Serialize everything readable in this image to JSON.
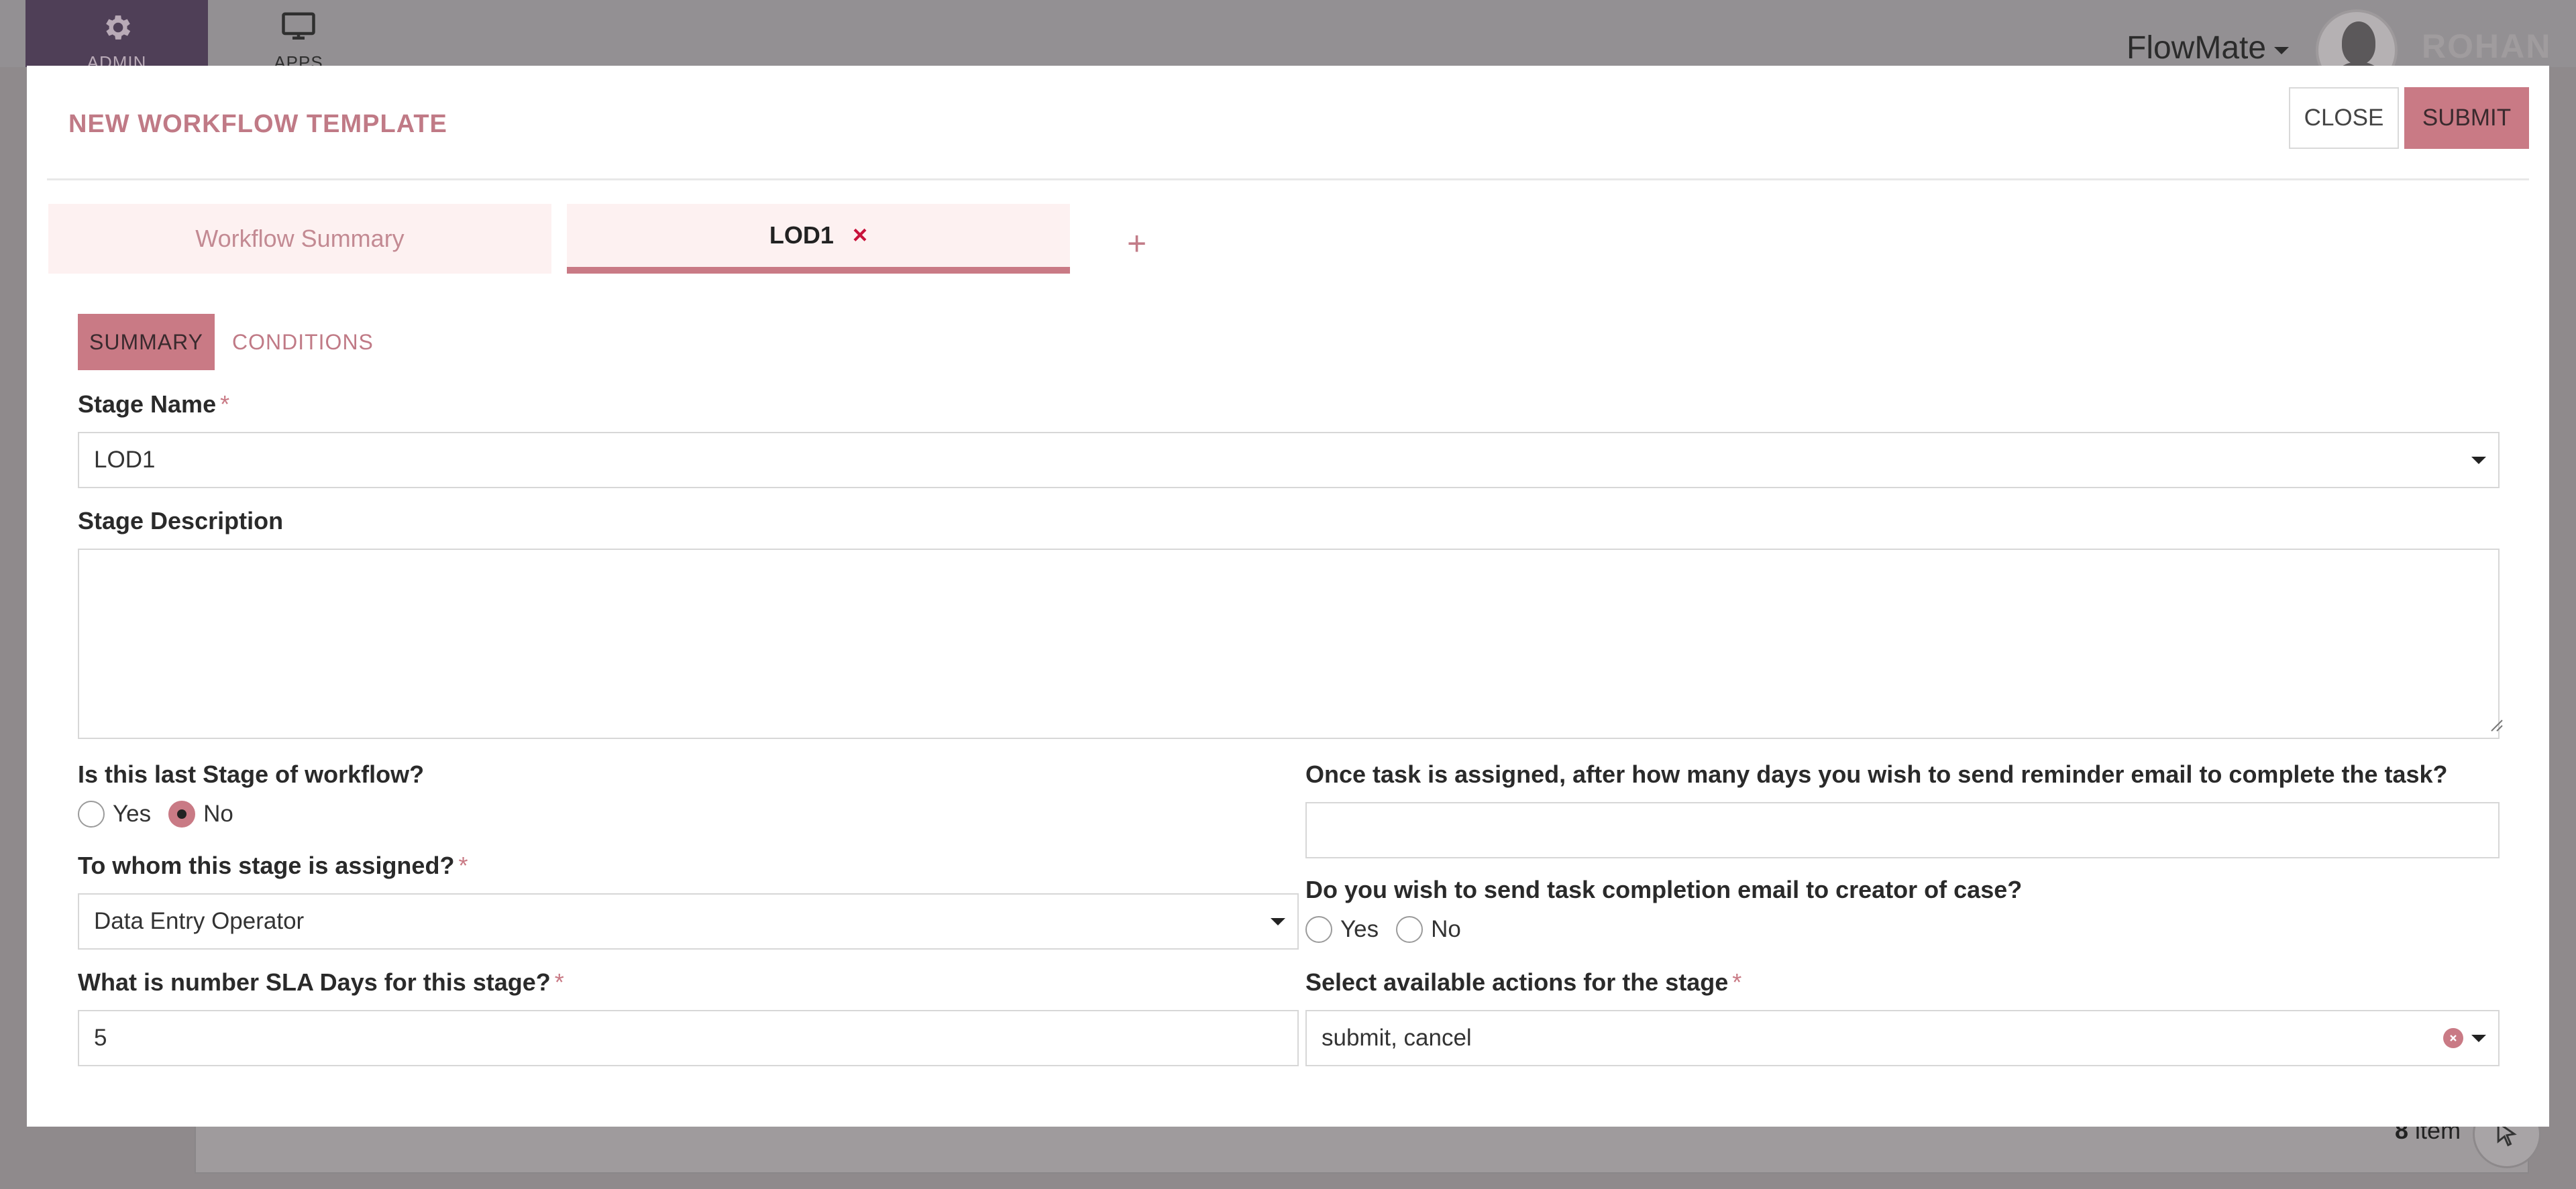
{
  "background": {
    "nav": {
      "admin_label": "ADMIN",
      "apps_label": "APPS"
    },
    "brand": "FlowMate",
    "user_name": "ROHAN",
    "items_count": "8",
    "items_label": "item"
  },
  "modal": {
    "title": "NEW WORKFLOW TEMPLATE",
    "close_label": "CLOSE",
    "submit_label": "SUBMIT",
    "stage_tabs": [
      {
        "label": "Workflow Summary",
        "active": false
      },
      {
        "label": "LOD1",
        "active": true,
        "remove_icon": "×"
      }
    ],
    "add_stage_icon": "+",
    "sub_tabs": [
      {
        "label": "SUMMARY",
        "active": true
      },
      {
        "label": "CONDITIONS",
        "active": false
      }
    ],
    "form": {
      "stage_name": {
        "label": "Stage Name",
        "required_mark": "*",
        "value": "LOD1"
      },
      "stage_description": {
        "label": "Stage Description",
        "value": ""
      },
      "is_last_stage": {
        "label": "Is this last Stage of workflow?",
        "options": [
          "Yes",
          "No"
        ],
        "selected": "No"
      },
      "assigned_to": {
        "label": "To whom this stage is assigned?",
        "required_mark": "*",
        "value": "Data Entry Operator"
      },
      "sla_days": {
        "label": "What is number SLA Days for this stage?",
        "required_mark": "*",
        "value": "5"
      },
      "reminder_days": {
        "label": "Once task is assigned, after how many days you wish to send reminder email to complete the task?",
        "value": ""
      },
      "completion_email": {
        "label": "Do you wish to send task completion email to creator of case?",
        "options": [
          "Yes",
          "No"
        ],
        "selected": ""
      },
      "available_actions": {
        "label": "Select available actions for the stage",
        "required_mark": "*",
        "value": "submit, cancel"
      }
    }
  },
  "colors": {
    "accent": "#c97a85",
    "accent_light": "#fdf1f1",
    "title": "#c07a86",
    "remove_x": "#c8123b",
    "overlay": "#8f8a8c"
  },
  "icons": {
    "admin": "gear-icon",
    "apps": "monitor-icon",
    "avatar": "user-avatar-icon",
    "fab": "cursor-icon",
    "clear": "clear-icon",
    "dropdown": "chevron-down-icon"
  }
}
